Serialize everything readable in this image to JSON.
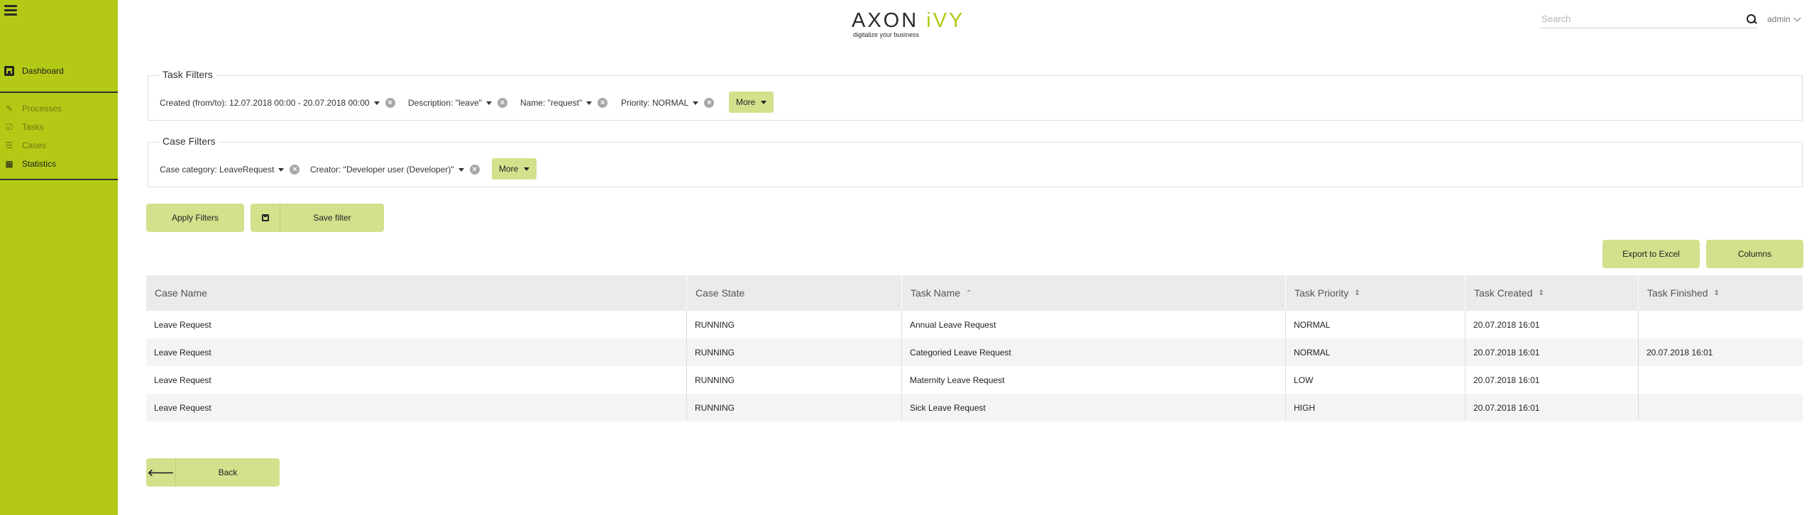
{
  "brand": {
    "name_main": "AXON ",
    "name_accent": "iVY",
    "tagline": "digitalize your business"
  },
  "header": {
    "search_placeholder": "Search",
    "user": "admin"
  },
  "sidebar": {
    "dashboard_label": "Dashboard",
    "items": [
      {
        "label": "Processes",
        "icon": "wrench-icon",
        "glyph": "✎"
      },
      {
        "label": "Tasks",
        "icon": "checkbox-icon",
        "glyph": "☑"
      },
      {
        "label": "Cases",
        "icon": "list-icon",
        "glyph": "☰"
      },
      {
        "label": "Statistics",
        "icon": "calendar-icon",
        "glyph": "▦"
      }
    ],
    "active": "Statistics"
  },
  "task_filters": {
    "legend": "Task Filters",
    "chips": [
      "Created (from/to): 12.07.2018 00:00 - 20.07.2018 00:00",
      "Description: \"leave\"",
      "Name: \"request\"",
      "Priority: NORMAL"
    ],
    "more_label": "More"
  },
  "case_filters": {
    "legend": "Case Filters",
    "chips": [
      "Case category: LeaveRequest",
      "Creator: \"Developer user (Developer)\""
    ],
    "more_label": "More"
  },
  "actions": {
    "apply_label": "Apply Filters",
    "save_label": "Save filter",
    "export_label": "Export to Excel",
    "columns_label": "Columns",
    "back_label": "Back"
  },
  "table": {
    "columns": [
      {
        "label": "Case Name",
        "sort": ""
      },
      {
        "label": "Case State",
        "sort": ""
      },
      {
        "label": "Task Name",
        "sort": "⌃"
      },
      {
        "label": "Task Priority",
        "sort": "⇕"
      },
      {
        "label": "Task Created",
        "sort": "⇕"
      },
      {
        "label": "Task Finished",
        "sort": "⇕"
      }
    ],
    "rows": [
      [
        "Leave Request",
        "RUNNING",
        "Annual Leave Request",
        "NORMAL",
        "20.07.2018 16:01",
        ""
      ],
      [
        "Leave Request",
        "RUNNING",
        "Categoried Leave Request",
        "NORMAL",
        "20.07.2018 16:01",
        "20.07.2018 16:01"
      ],
      [
        "Leave Request",
        "RUNNING",
        "Maternity Leave Request",
        "LOW",
        "20.07.2018 16:01",
        ""
      ],
      [
        "Leave Request",
        "RUNNING",
        "Sick Leave Request",
        "HIGH",
        "20.07.2018 16:01",
        ""
      ]
    ]
  },
  "colors": {
    "accent": "#b4c916",
    "button": "#d5e08c"
  }
}
